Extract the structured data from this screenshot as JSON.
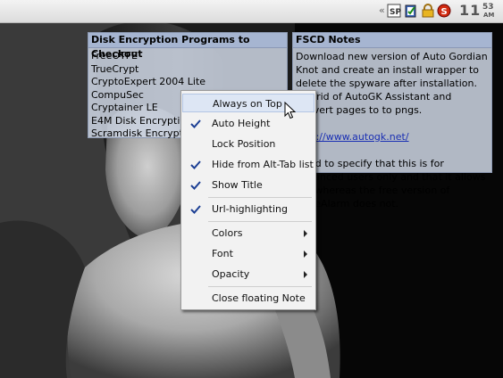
{
  "tray": {
    "arrow": "«",
    "icons": [
      "network-icon",
      "clipboard-check-icon",
      "lock-icon",
      "security-alert-icon"
    ],
    "clock": {
      "hour": "11",
      "minute": "53",
      "ampm": "AM"
    }
  },
  "notes": [
    {
      "title": "Disk Encryption Programs to Checkout",
      "items": [
        "FreeOTFE",
        "TrueCrypt",
        "CryptoExpert 2004 Lite",
        "CompuSec",
        "Cryptainer LE",
        "E4M Disk Encryption",
        "Scramdisk Encryption"
      ]
    },
    {
      "title": "FSCD Notes",
      "body_1": "Download new version of Auto Gordian Knot and create an install wrapper to delete the spyware after installation. Get rid of AutoGK Assistant and convert pages to to pngs.",
      "link": "http://www.autogk.net/",
      "body_2": "Need to specify that this is for advanced users only and that it allows ICS whereas the free version of ZoneAlarm does not."
    }
  ],
  "context_menu": {
    "items": [
      {
        "label": "Always on Top",
        "checked": false,
        "submenu": false,
        "highlighted": true
      },
      {
        "label": "Auto Height",
        "checked": true,
        "submenu": false
      },
      {
        "label": "Lock Position",
        "checked": false,
        "submenu": false
      },
      {
        "label": "Hide from Alt-Tab list",
        "checked": true,
        "submenu": false
      },
      {
        "label": "Show Title",
        "checked": true,
        "submenu": false
      },
      {
        "label": "Url-highlighting",
        "checked": true,
        "submenu": false
      },
      {
        "label": "Colors",
        "checked": false,
        "submenu": true
      },
      {
        "label": "Font",
        "checked": false,
        "submenu": true
      },
      {
        "label": "Opacity",
        "checked": false,
        "submenu": true
      },
      {
        "label": "Close floating Note",
        "checked": false,
        "submenu": false
      }
    ]
  },
  "colors": {
    "note_title_bg": "#a6b5d1",
    "note_bg": "#ced6e4",
    "link": "#1a2fb3",
    "menu_highlight": "#dde6f4"
  }
}
